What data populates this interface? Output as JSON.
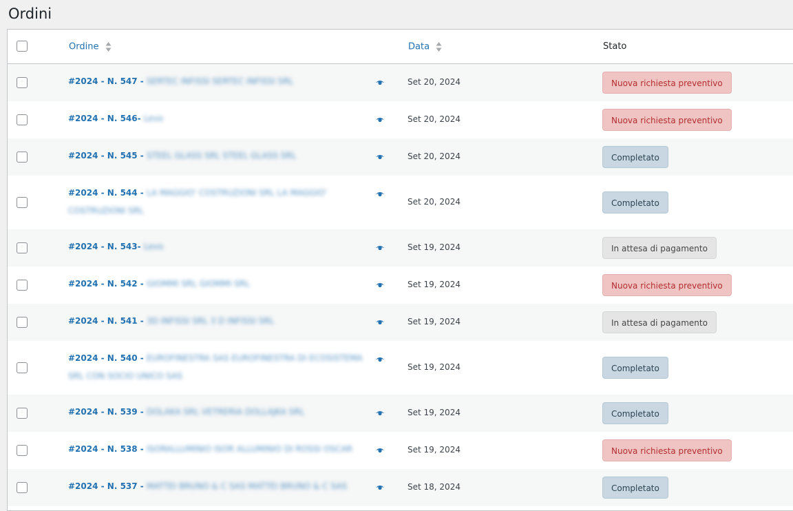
{
  "page": {
    "title": "Ordini"
  },
  "columns": {
    "ordine": "Ordine",
    "data": "Data",
    "stato": "Stato"
  },
  "colors": {
    "link": "#2271b1",
    "status_red": "#f1c4c4",
    "status_blue": "#c8d7e1",
    "status_grey": "#e5e5e5"
  },
  "orders": [
    {
      "number": "#2024 - N. 547",
      "sep": " - ",
      "customer": "SERTEC INFISSI SERTEC INFISSI SRL",
      "date": "Set 20, 2024",
      "status": "Nuova richiesta preventivo",
      "status_type": "red"
    },
    {
      "number": "#2024 - N. 546",
      "sep": "- ",
      "customer": "Levo",
      "date": "Set 20, 2024",
      "status": "Nuova richiesta preventivo",
      "status_type": "red"
    },
    {
      "number": "#2024 - N. 545",
      "sep": " - ",
      "customer": "STEEL GLASS SRL STEEL GLASS SRL",
      "date": "Set 20, 2024",
      "status": "Completato",
      "status_type": "blue"
    },
    {
      "number": "#2024 - N. 544",
      "sep": " - ",
      "customer": "LA MAGGIO' COSTRUZIONI SRL LA MAGGIO' COSTRUZIONI SRL",
      "date": "Set 20, 2024",
      "status": "Completato",
      "status_type": "blue"
    },
    {
      "number": "#2024 - N. 543",
      "sep": "- ",
      "customer": "Levo",
      "date": "Set 19, 2024",
      "status": "In attesa di pagamento",
      "status_type": "grey"
    },
    {
      "number": "#2024 - N. 542",
      "sep": " - ",
      "customer": "GIOMMI SRL GIOMMI SRL",
      "date": "Set 19, 2024",
      "status": "Nuova richiesta preventivo",
      "status_type": "red"
    },
    {
      "number": "#2024 - N. 541",
      "sep": " - ",
      "customer": "3D INFISSI SRL 3 D INFISSI SRL",
      "date": "Set 19, 2024",
      "status": "In attesa di pagamento",
      "status_type": "grey"
    },
    {
      "number": "#2024 - N. 540",
      "sep": " - ",
      "customer": "EUROFINESTRA SAS EUROFINESTRA DI ECOSISTEMA SRL CON SOCIO UNICO SAS",
      "date": "Set 19, 2024",
      "status": "Completato",
      "status_type": "blue"
    },
    {
      "number": "#2024 - N. 539",
      "sep": " - ",
      "customer": "DOLAKA SRL VETRERIA DOLLAJKA SRL",
      "date": "Set 19, 2024",
      "status": "Completato",
      "status_type": "blue"
    },
    {
      "number": "#2024 - N. 538",
      "sep": " - ",
      "customer": "ISORALLUMINIO ISOR ALLUMINIO DI ROSSI OSCAR",
      "date": "Set 19, 2024",
      "status": "Nuova richiesta preventivo",
      "status_type": "red"
    },
    {
      "number": "#2024 - N. 537",
      "sep": " - ",
      "customer": "MATTEI BRUNO & C SAS MATTEI BRUNO & C SAS",
      "date": "Set 18, 2024",
      "status": "Completato",
      "status_type": "blue"
    }
  ]
}
